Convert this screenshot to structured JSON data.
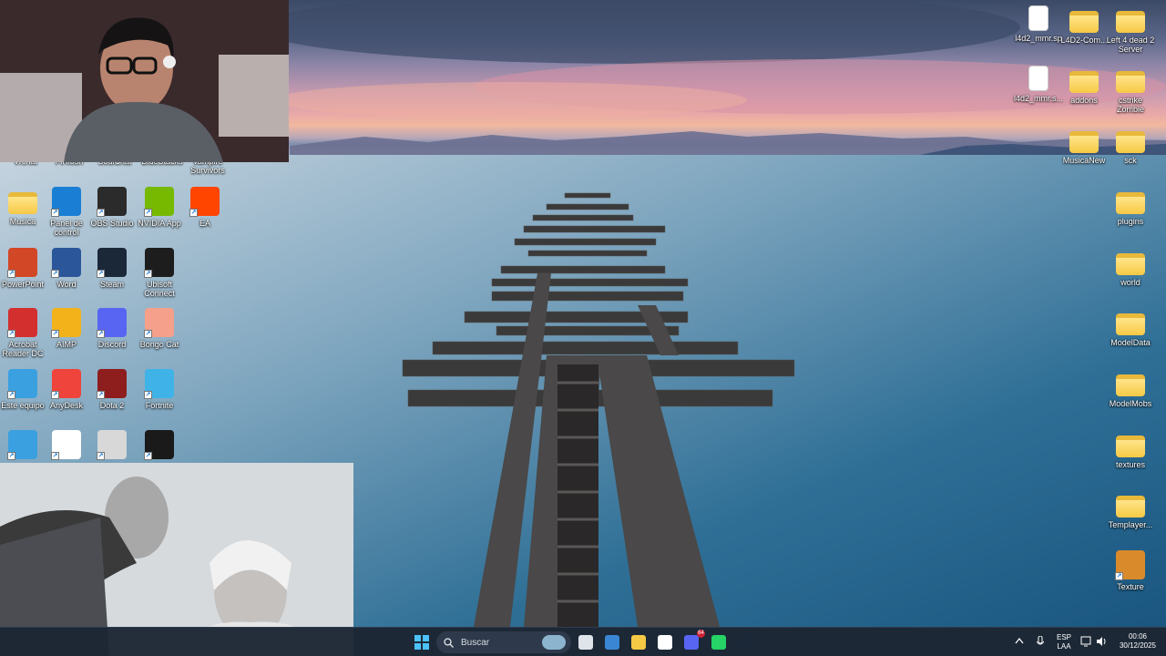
{
  "left_icons": [
    {
      "label": "Musica",
      "type": "folder"
    },
    {
      "label": "Panel de control",
      "type": "app",
      "icon": "control-panel-icon",
      "color": "#1a7fd4"
    },
    {
      "label": "OBS Studio",
      "type": "app",
      "icon": "obs-icon",
      "color": "#2b2b2b"
    },
    {
      "label": "NVIDIA App",
      "type": "app",
      "icon": "nvidia-icon",
      "color": "#76b900"
    },
    {
      "label": "EA",
      "type": "app",
      "icon": "ea-icon",
      "color": "#ff4500"
    },
    {
      "label": "PowerPoint",
      "type": "app",
      "icon": "powerpoint-icon",
      "color": "#d24726"
    },
    {
      "label": "Word",
      "type": "app",
      "icon": "word-icon",
      "color": "#2b579a"
    },
    {
      "label": "Steam",
      "type": "app",
      "icon": "steam-icon",
      "color": "#1b2838"
    },
    {
      "label": "Ubisoft Connect",
      "type": "app",
      "icon": "ubisoft-icon",
      "color": "#1d1d1d"
    },
    {
      "label": "Acrobat Reader DC",
      "type": "app",
      "icon": "acrobat-icon",
      "color": "#d32f2f"
    },
    {
      "label": "AIMP",
      "type": "app",
      "icon": "aimp-icon",
      "color": "#f3b21a"
    },
    {
      "label": "Discord",
      "type": "app",
      "icon": "discord-icon",
      "color": "#5865f2"
    },
    {
      "label": "Bongo Cat",
      "type": "app",
      "icon": "bongo-cat-icon",
      "color": "#f4a08a"
    },
    {
      "label": "Este equipo",
      "type": "app",
      "icon": "this-pc-icon",
      "color": "#3aa0e0"
    },
    {
      "label": "AnyDesk",
      "type": "app",
      "icon": "anydesk-icon",
      "color": "#ef443b"
    },
    {
      "label": "Dota 2",
      "type": "app",
      "icon": "dota2-icon",
      "color": "#8e1d1d"
    },
    {
      "label": "Fortnite",
      "type": "app",
      "icon": "fortnite-icon",
      "color": "#3fb3e8"
    },
    {
      "label": "",
      "type": "app",
      "icon": "network-icon",
      "color": "#3aa0e0"
    },
    {
      "label": "",
      "type": "app",
      "icon": "chrome-icon",
      "color": "#ffffff"
    },
    {
      "label": "",
      "type": "app",
      "icon": "counter-strike-icon",
      "color": "#d8d8d8"
    },
    {
      "label": "",
      "type": "app",
      "icon": "dead-rising-3-icon",
      "color": "#1a1a1a"
    }
  ],
  "partial_labels": [
    "Vrchat",
    "FlHlosh",
    "SoulChat",
    "BlueStacks",
    "Vampire Survivors"
  ],
  "right_icons": [
    {
      "label": "l4d2_mmr.sp",
      "type": "file"
    },
    {
      "label": "L4D2-Com...",
      "type": "folder"
    },
    {
      "label": "Left 4 dead 2 Server",
      "type": "folder"
    },
    {
      "label": "l4d2_mmr.s...",
      "type": "file"
    },
    {
      "label": "addons",
      "type": "folder"
    },
    {
      "label": "cstrike Zombie",
      "type": "folder"
    },
    {
      "label": "MusicaNew",
      "type": "folder"
    },
    {
      "label": "sck",
      "type": "folder"
    },
    {
      "label": "plugins",
      "type": "folder"
    },
    {
      "label": "world",
      "type": "folder"
    },
    {
      "label": "ModelData",
      "type": "folder"
    },
    {
      "label": "ModelMobs",
      "type": "folder"
    },
    {
      "label": "textures",
      "type": "folder"
    },
    {
      "label": "Templayer...",
      "type": "folder"
    },
    {
      "label": "Texture",
      "type": "app",
      "icon": "burger-icon",
      "color": "#d98a2b"
    }
  ],
  "taskbar": {
    "search_placeholder": "Buscar",
    "pinned": [
      {
        "name": "task-view-icon",
        "color": "#dfe4ea"
      },
      {
        "name": "store-icon",
        "color": "#3a86d4"
      },
      {
        "name": "file-explorer-icon",
        "color": "#f6c945"
      },
      {
        "name": "chrome-icon",
        "color": "#ffffff"
      },
      {
        "name": "discord-icon",
        "color": "#5865f2"
      },
      {
        "name": "whatsapp-icon",
        "color": "#25d366"
      },
      {
        "name": "steam-icon",
        "color": "#1b2838"
      }
    ],
    "discord_badge": "64",
    "chrome_badge": "",
    "language_line1": "ESP",
    "language_line2": "LAA",
    "time": "00:06",
    "date": "30/12/2025"
  }
}
